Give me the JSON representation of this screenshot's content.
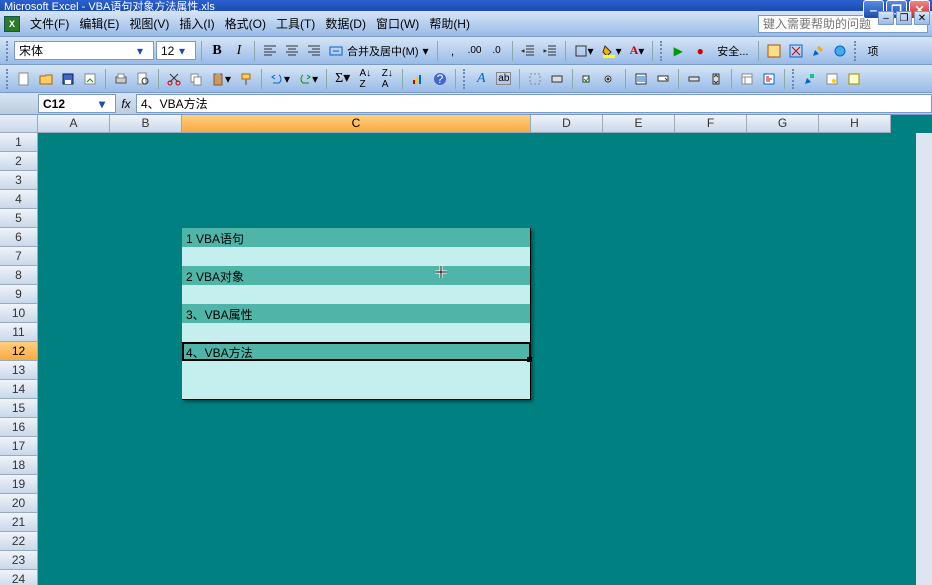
{
  "title": "Microsoft Excel - VBA语句对象方法属性.xls",
  "menus": [
    "文件(F)",
    "编辑(E)",
    "视图(V)",
    "插入(I)",
    "格式(O)",
    "工具(T)",
    "数据(D)",
    "窗口(W)",
    "帮助(H)"
  ],
  "help_placeholder": "键入需要帮助的问题",
  "font": {
    "name": "宋体",
    "size": "12"
  },
  "merge_center": "合并及居中(M)",
  "security": "安全...",
  "item_btn": "项",
  "namebox": "C12",
  "formula": "4、VBA方法",
  "columns": {
    "A": 72,
    "B": 72,
    "C": 349,
    "D": 72,
    "E": 72,
    "F": 72,
    "G": 72,
    "H": 72
  },
  "active_col": "C",
  "active_row": 12,
  "rows_count": 24,
  "content": {
    "r6": "1 VBA语句",
    "r7": "",
    "r8": "2 VBA对象",
    "r9": "",
    "r10": "3、VBA属性",
    "r11": "",
    "r12": "4、VBA方法",
    "r13": "",
    "r14": ""
  }
}
